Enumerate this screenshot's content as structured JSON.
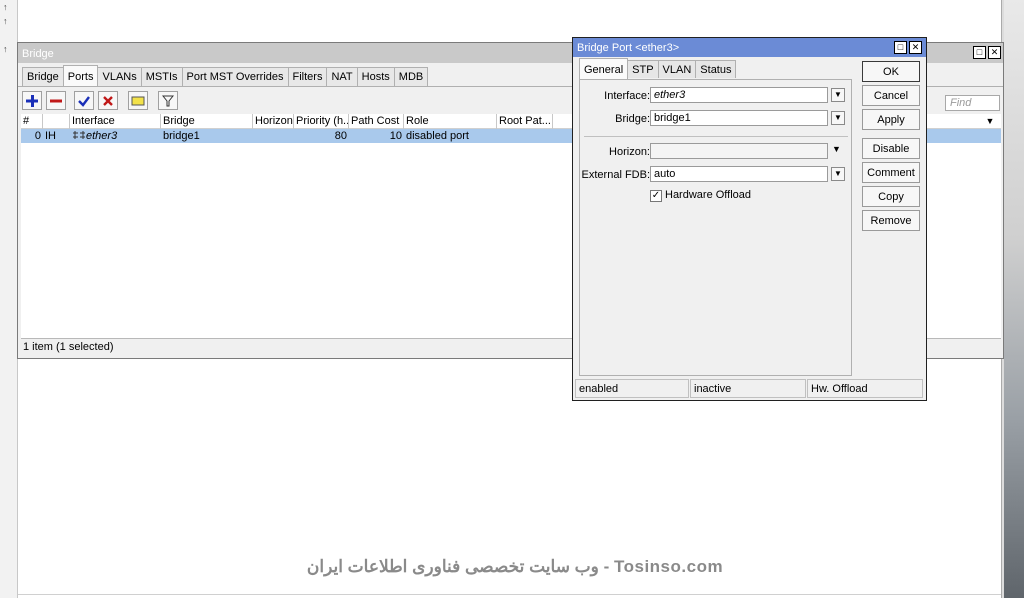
{
  "bridge_window": {
    "title": "Bridge",
    "tabs": [
      "Bridge",
      "Ports",
      "VLANs",
      "MSTIs",
      "Port MST Overrides",
      "Filters",
      "NAT",
      "Hosts",
      "MDB"
    ],
    "find_placeholder": "Find",
    "columns": [
      "#",
      "",
      "Interface",
      "Bridge",
      "Horizon",
      "Priority (h...",
      "Path Cost",
      "Role",
      "Root Pat..."
    ],
    "rows": [
      {
        "num": "0",
        "flags": "IH",
        "interface": "ether3",
        "bridge": "bridge1",
        "horizon": "",
        "priority": "80",
        "path_cost": "10",
        "role": "disabled port",
        "root_path": ""
      }
    ],
    "status": "1 item (1 selected)"
  },
  "dialog": {
    "title": "Bridge Port <ether3>",
    "tabs": [
      "General",
      "STP",
      "VLAN",
      "Status"
    ],
    "fields": {
      "interface_label": "Interface:",
      "interface_value": "ether3",
      "bridge_label": "Bridge:",
      "bridge_value": "bridge1",
      "horizon_label": "Horizon:",
      "horizon_value": "",
      "external_fdb_label": "External FDB:",
      "external_fdb_value": "auto",
      "hw_offload_label": "Hardware Offload",
      "hw_offload_checked": true
    },
    "buttons": [
      "OK",
      "Cancel",
      "Apply",
      "Disable",
      "Comment",
      "Copy",
      "Remove"
    ],
    "status": [
      "enabled",
      "inactive",
      "Hw. Offload"
    ]
  },
  "watermark": "وب سایت تخصصی فناوری اطلاعات ایران - Tosinso.com",
  "colors": {
    "selected_row": "#a9c9ec",
    "dialog_title": "#6b8bd6",
    "inactive_title": "#c9c9c9"
  }
}
